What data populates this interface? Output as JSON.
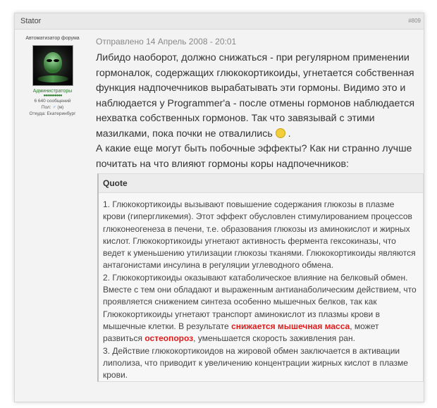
{
  "post": {
    "author": "Stator",
    "post_number": "#809",
    "posted_label": "Отправлено 14 Апрель 2008 - 20:01"
  },
  "profile": {
    "rank": "Автоматизатор форума",
    "group": "Администраторы",
    "stars": "●●●●●●●●●●",
    "posts": "6 640 сообщений",
    "gender_label": "Пол:",
    "gender_value": "(м)",
    "from": "Откуда: Екатеринбург"
  },
  "message": {
    "paragraph1": "Либидо наоборот, должно снижаться - при регулярном применении гормоналок, содержащих глюкокортикоиды, угнетается собственная функция надпочечников вырабатывать эти гормоны. Видимо это и наблюдается у Programmer'a - после отмены гормонов наблюдается нехватка собственных гормонов. Так что завязывай с этими мазилками, пока почки не отвалились",
    "after_smiley": " .",
    "paragraph2": "А какие еще могут быть побочные эффекты? Как ни странно лучше почитать на что влияют гормоны коры надпочечников:"
  },
  "quote": {
    "title": "Quote",
    "item1": "1. Глюкокортикоиды вызывают повышение содержания глюкозы в плазме крови (гипергликемия). Этот эффект обусловлен стимулированием процессов глюконеогенеза в печени, т.е. образования глюкозы из аминокислот и жирных кислот. Глюкокортикоиды угнетают активность фермента гексокиназы, что ведет к уменьшению утилизации глюкозы тканями. Глюкокортикоиды являются антагонистами инсулина в регуляции углеводного обмена.",
    "item2_part1": "2. Глюкокортикоиды оказывают катаболическое влияние на белковый обмен. Вместе с тем они обладают и выраженным антианаболическим действием, что проявляется снижением синтеза особенно мышечных белков, так как Глюкокортикоиды угнетают транспорт аминокислот из плазмы крови в мышечные клетки. В результате ",
    "item2_red1": "снижается мышечная масса",
    "item2_part2": ", может развиться ",
    "item2_red2": "остеопороз",
    "item2_part3": ", уменьшается скорость заживления ран.",
    "item3": "3. Действие глюкокортикоидов на жировой обмен заключается в активации липолиза, что приводит к увеличению концентрации жирных кислот в плазме крови."
  }
}
